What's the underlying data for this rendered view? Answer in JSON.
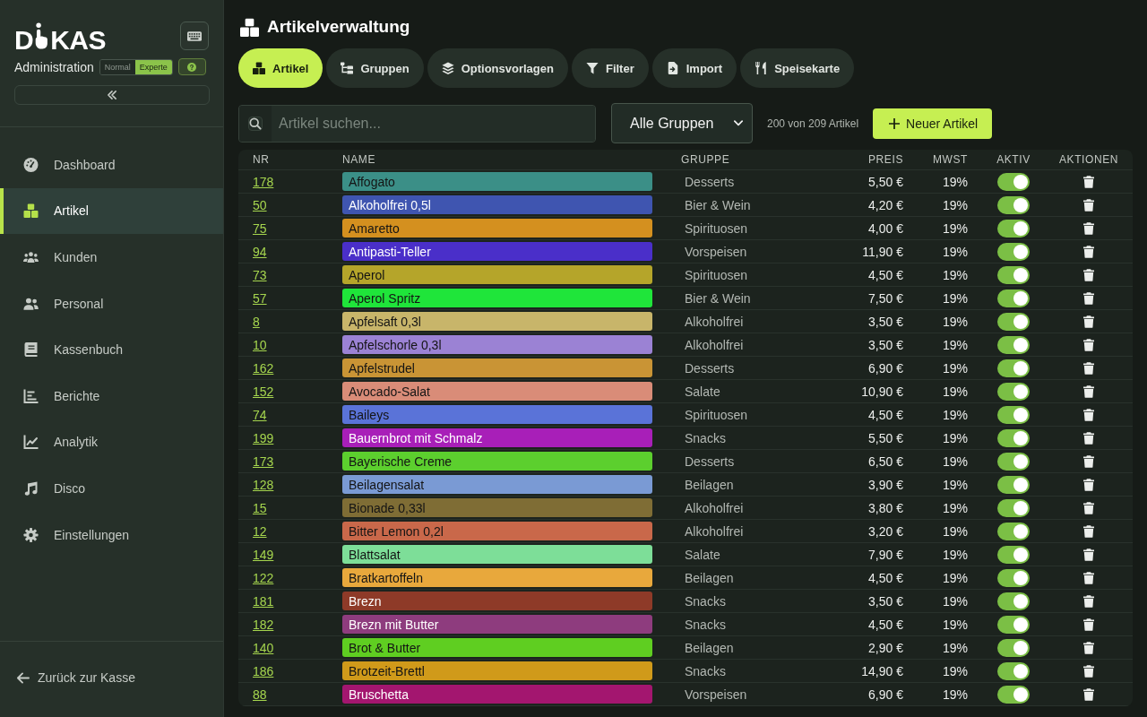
{
  "sidebar": {
    "logo": {
      "start": "D",
      "end": "KAS"
    },
    "subtitle": "Administration",
    "mode_toggle": [
      {
        "label": "Normal",
        "selected": false
      },
      {
        "label": "Experte",
        "selected": true
      }
    ],
    "nav": [
      {
        "label": "Dashboard",
        "selected": false
      },
      {
        "label": "Artikel",
        "selected": true
      },
      {
        "label": "Kunden",
        "selected": false
      },
      {
        "label": "Personal",
        "selected": false
      },
      {
        "label": "Kassenbuch",
        "selected": false
      },
      {
        "label": "Berichte",
        "selected": false
      },
      {
        "label": "Analytik",
        "selected": false
      },
      {
        "label": "Disco",
        "selected": false
      },
      {
        "label": "Einstellungen",
        "selected": false
      }
    ],
    "back_link": "Zurück zur Kasse"
  },
  "page_title": "Artikelverwaltung",
  "tabs": [
    {
      "label": "Artikel",
      "selected": true
    },
    {
      "label": "Gruppen",
      "selected": false
    },
    {
      "label": "Optionsvorlagen",
      "selected": false
    },
    {
      "label": "Filter",
      "selected": false
    },
    {
      "label": "Import",
      "selected": false
    },
    {
      "label": "Speisekarte",
      "selected": false
    }
  ],
  "toolbar": {
    "search": {
      "placeholder": "Artikel suchen..."
    },
    "group_select": "Alle Gruppen",
    "count": "200 von 209 Artikel",
    "new_button": "Neuer Artikel"
  },
  "table": {
    "columns": [
      "NR",
      "NAME",
      "GRUPPE",
      "PREIS",
      "MWST",
      "AKTIV",
      "AKTIONEN"
    ],
    "rows": [
      {
        "nr": "178",
        "name": "Affogato",
        "color": "#3b8f87",
        "group": "Desserts",
        "price": "5,50 €",
        "vat": "19%",
        "active": true
      },
      {
        "nr": "50",
        "name": "Alkoholfrei 0,5l",
        "color": "#3f55b0",
        "group": "Bier & Wein",
        "price": "4,20 €",
        "vat": "19%",
        "active": true
      },
      {
        "nr": "75",
        "name": "Amaretto",
        "color": "#d4901f",
        "group": "Spirituosen",
        "price": "4,00 €",
        "vat": "19%",
        "active": true
      },
      {
        "nr": "94",
        "name": "Antipasti-Teller",
        "color": "#4a2fc9",
        "group": "Vorspeisen",
        "price": "11,90 €",
        "vat": "19%",
        "active": true
      },
      {
        "nr": "73",
        "name": "Aperol",
        "color": "#b5a52a",
        "group": "Spirituosen",
        "price": "4,50 €",
        "vat": "19%",
        "active": true
      },
      {
        "nr": "57",
        "name": "Aperol Spritz",
        "color": "#1fe53a",
        "group": "Bier & Wein",
        "price": "7,50 €",
        "vat": "19%",
        "active": true
      },
      {
        "nr": "8",
        "name": "Apfelsaft 0,3l",
        "color": "#c8b56a",
        "group": "Alkoholfrei",
        "price": "3,50 €",
        "vat": "19%",
        "active": true
      },
      {
        "nr": "10",
        "name": "Apfelschorle 0,3l",
        "color": "#9b82d4",
        "group": "Alkoholfrei",
        "price": "3,50 €",
        "vat": "19%",
        "active": true
      },
      {
        "nr": "162",
        "name": "Apfelstrudel",
        "color": "#c99435",
        "group": "Desserts",
        "price": "6,90 €",
        "vat": "19%",
        "active": true
      },
      {
        "nr": "152",
        "name": "Avocado-Salat",
        "color": "#d98c78",
        "group": "Salate",
        "price": "10,90 €",
        "vat": "19%",
        "active": true
      },
      {
        "nr": "74",
        "name": "Baileys",
        "color": "#5a73d8",
        "group": "Spirituosen",
        "price": "4,50 €",
        "vat": "19%",
        "active": true
      },
      {
        "nr": "199",
        "name": "Bauernbrot mit Schmalz",
        "color": "#a81fb8",
        "group": "Snacks",
        "price": "5,50 €",
        "vat": "19%",
        "active": true
      },
      {
        "nr": "173",
        "name": "Bayerische Creme",
        "color": "#5ccf2e",
        "group": "Desserts",
        "price": "6,50 €",
        "vat": "19%",
        "active": true
      },
      {
        "nr": "128",
        "name": "Beilagensalat",
        "color": "#7a9ad4",
        "group": "Beilagen",
        "price": "3,90 €",
        "vat": "19%",
        "active": true
      },
      {
        "nr": "15",
        "name": "Bionade 0,33l",
        "color": "#7f6d35",
        "group": "Alkoholfrei",
        "price": "3,80 €",
        "vat": "19%",
        "active": true
      },
      {
        "nr": "12",
        "name": "Bitter Lemon 0,2l",
        "color": "#c9684a",
        "group": "Alkoholfrei",
        "price": "3,20 €",
        "vat": "19%",
        "active": true
      },
      {
        "nr": "149",
        "name": "Blattsalat",
        "color": "#7dde98",
        "group": "Salate",
        "price": "7,90 €",
        "vat": "19%",
        "active": true
      },
      {
        "nr": "122",
        "name": "Bratkartoffeln",
        "color": "#e8a83c",
        "group": "Beilagen",
        "price": "4,50 €",
        "vat": "19%",
        "active": true
      },
      {
        "nr": "181",
        "name": "Brezn",
        "color": "#8e3a28",
        "group": "Snacks",
        "price": "3,50 €",
        "vat": "19%",
        "active": true
      },
      {
        "nr": "182",
        "name": "Brezn mit Butter",
        "color": "#8e3c7e",
        "group": "Snacks",
        "price": "4,50 €",
        "vat": "19%",
        "active": true
      },
      {
        "nr": "140",
        "name": "Brot & Butter",
        "color": "#5fce21",
        "group": "Beilagen",
        "price": "2,90 €",
        "vat": "19%",
        "active": true
      },
      {
        "nr": "186",
        "name": "Brotzeit-Brettl",
        "color": "#d09a1a",
        "group": "Snacks",
        "price": "14,90 €",
        "vat": "19%",
        "active": true
      },
      {
        "nr": "88",
        "name": "Bruschetta",
        "color": "#a3166f",
        "group": "Vorspeisen",
        "price": "6,90 €",
        "vat": "19%",
        "active": true
      }
    ]
  }
}
